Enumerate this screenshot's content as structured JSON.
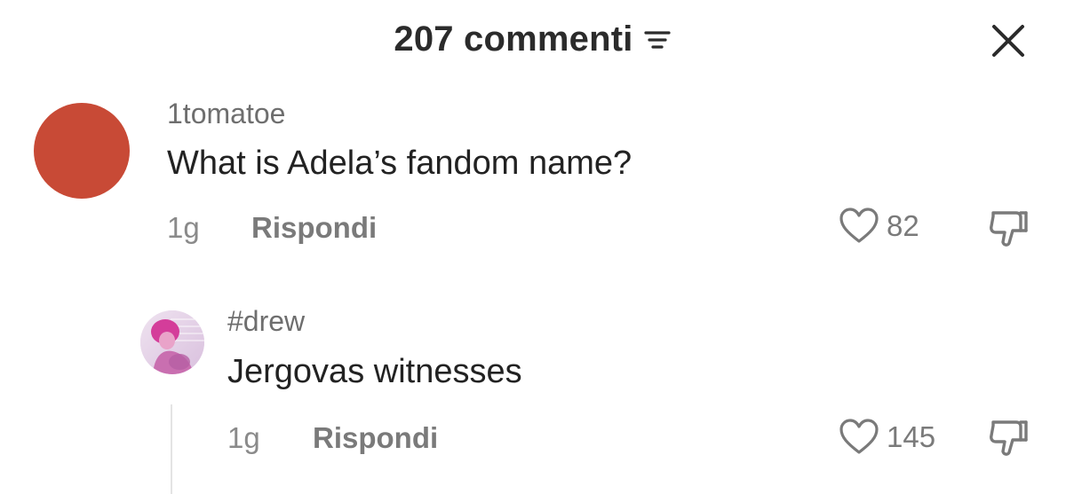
{
  "header": {
    "title": "207 commenti",
    "sort_icon": "filter-lines-icon",
    "close_icon": "close-x-icon"
  },
  "comments": [
    {
      "username": "1tomatoe",
      "text": "What is Adela’s fandom name?",
      "time": "1g",
      "reply_label": "Rispondi",
      "likes": "82",
      "avatar_color": "#c84a36"
    },
    {
      "username": "#drew",
      "text": "Jergovas witnesses",
      "time": "1g",
      "reply_label": "Rispondi",
      "likes": "145",
      "avatar_color": "#e8d6ea"
    }
  ],
  "colors": {
    "username": "#6e6e6e",
    "meta": "#8a8a8a",
    "text": "#222222"
  }
}
